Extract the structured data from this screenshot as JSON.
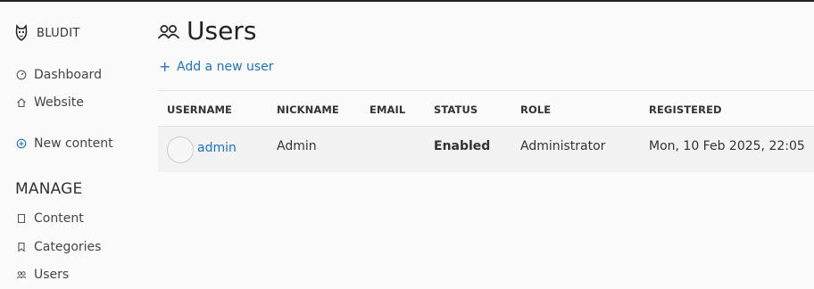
{
  "app": {
    "name": "BLUDIT"
  },
  "sidebar": {
    "items": [
      {
        "label": "Dashboard",
        "icon": "dashboard-icon"
      },
      {
        "label": "Website",
        "icon": "home-icon"
      },
      {
        "label": "New content",
        "icon": "plus-circle-icon"
      }
    ],
    "manage_title": "MANAGE",
    "manage_items": [
      {
        "label": "Content",
        "icon": "document-icon"
      },
      {
        "label": "Categories",
        "icon": "bookmark-icon"
      },
      {
        "label": "Users",
        "icon": "users-icon"
      }
    ]
  },
  "page": {
    "title": "Users",
    "add_user_label": "Add a new user"
  },
  "table": {
    "headers": [
      "USERNAME",
      "NICKNAME",
      "EMAIL",
      "STATUS",
      "ROLE",
      "REGISTERED"
    ],
    "rows": [
      {
        "username": "admin",
        "nickname": "Admin",
        "email": "",
        "status": "Enabled",
        "role": "Administrator",
        "registered": "Mon, 10 Feb 2025, 22:05"
      }
    ]
  },
  "colors": {
    "link": "#1a73c8",
    "text": "#333333",
    "row_bg": "#f2f2f2"
  }
}
